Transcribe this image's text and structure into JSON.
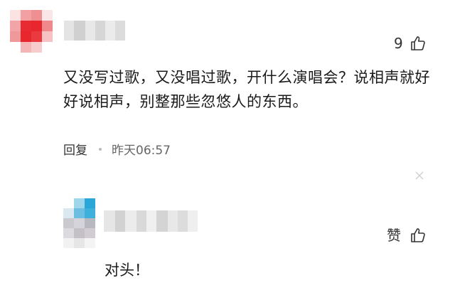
{
  "comment": {
    "like_count": "9",
    "text": "又没写过歌，又没唱过歌，开什么演唱会？说相声就好好说相声，别整那些忽悠人的东西。",
    "reply_label": "回复",
    "time": "昨天06:57",
    "avatar_icon": "pixelated-avatar-icon",
    "like_icon": "thumbs-up-icon"
  },
  "reply": {
    "like_label": "赞",
    "text": "对头！",
    "avatar_icon": "pixelated-avatar-icon",
    "like_icon": "thumbs-up-icon"
  },
  "colors": {
    "avatar_red": "#e8262d",
    "avatar_light_red": "#f08a8c",
    "avatar_blue": "#2aa7d8",
    "blur_gray": "#d9d9d9"
  }
}
